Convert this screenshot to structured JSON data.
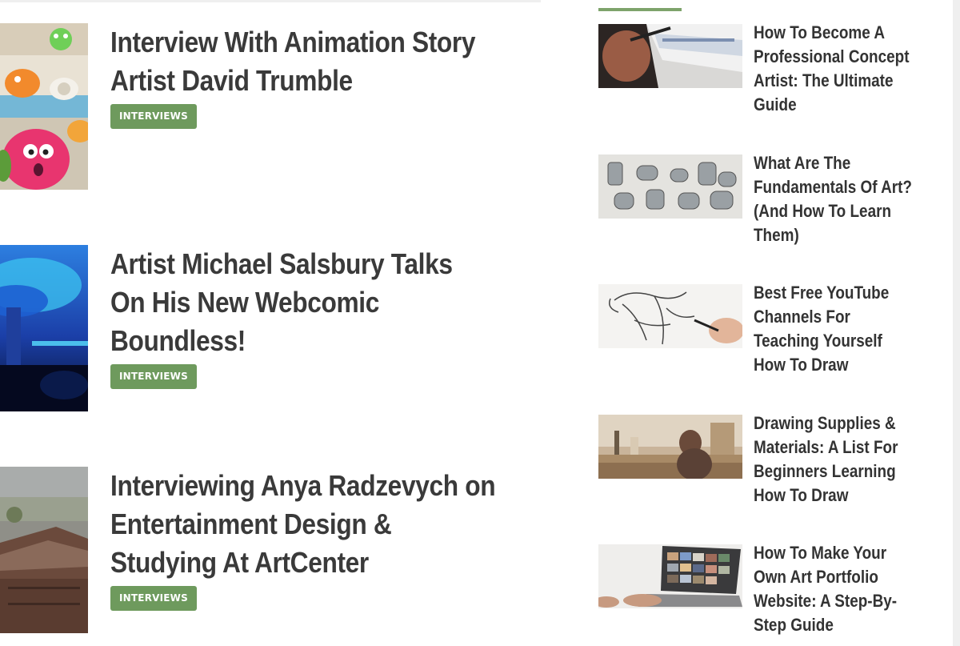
{
  "posts": [
    {
      "title_lines": [
        "Interview With Animation Story",
        "Artist David Trumble"
      ],
      "category": "INTERVIEWS",
      "thumb_icon": "clay-characters-image"
    },
    {
      "title_lines": [
        "Artist Michael Salsbury Talks",
        "On His New Webcomic",
        "Boundless!"
      ],
      "category": "INTERVIEWS",
      "thumb_icon": "blue-tree-artwork-image"
    },
    {
      "title_lines": [
        "Interviewing Anya Radzevych on",
        "Entertainment Design &",
        "Studying At ArtCenter"
      ],
      "category": "INTERVIEWS",
      "thumb_icon": "city-rooftops-image"
    }
  ],
  "sidebar": {
    "accent_color": "#7ea36b",
    "items": [
      {
        "title_lines": [
          "How To Become A",
          "Professional Concept",
          "Artist: The Ultimate",
          "Guide"
        ],
        "thumb_icon": "drawing-tablet-image"
      },
      {
        "title_lines": [
          "What Are The",
          "Fundamentals Of Art?",
          "(And How To Learn",
          "Them)"
        ],
        "thumb_icon": "cylinder-sketches-image"
      },
      {
        "title_lines": [
          "Best Free YouTube",
          "Channels For",
          "Teaching Yourself",
          "How To Draw"
        ],
        "thumb_icon": "anatomy-sketch-image"
      },
      {
        "title_lines": [
          "Drawing Supplies &",
          "Materials: A List For",
          "Beginners Learning",
          "How To Draw"
        ],
        "thumb_icon": "art-studio-image"
      },
      {
        "title_lines": [
          "How To Make Your",
          "Own Art Portfolio",
          "Website: A Step-By-",
          "Step Guide"
        ],
        "thumb_icon": "laptop-portfolio-image"
      }
    ]
  },
  "colors": {
    "badge": "#6e9a5d",
    "title_text": "#3a3a3a"
  }
}
